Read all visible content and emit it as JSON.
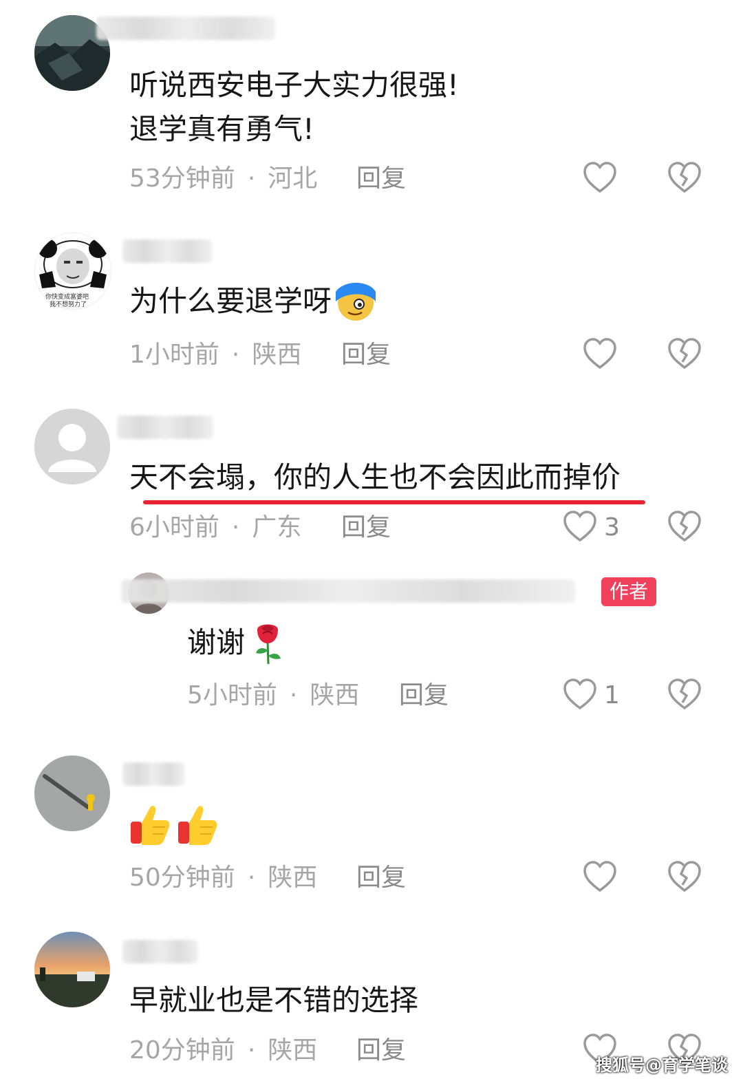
{
  "comments": [
    {
      "text_lines": [
        "听说西安电子大实力很强!",
        "退学真有勇气!"
      ],
      "time": "53分钟前",
      "location": "河北",
      "reply_label": "回复",
      "like_count": "",
      "avatar_icon": "avatar-dark-landscape"
    },
    {
      "text": "为什么要退学呀",
      "emoji": "face-emoji",
      "time": "1小时前",
      "location": "陕西",
      "reply_label": "回复",
      "like_count": "",
      "avatar_icon": "avatar-panda-meme",
      "avatar_caption_1": "你快变成富婆吧",
      "avatar_caption_2": "我不想努力了"
    },
    {
      "text": "天不会塌，你的人生也不会因此而掉价",
      "time": "6小时前",
      "location": "广东",
      "reply_label": "回复",
      "like_count": "3",
      "highlight_color": "#e8232f",
      "avatar_icon": "avatar-default-person",
      "replies": [
        {
          "badge": "作者",
          "text": "谢谢",
          "emoji": "rose-emoji",
          "time": "5小时前",
          "location": "陕西",
          "reply_label": "回复",
          "like_count": "1"
        }
      ]
    },
    {
      "emoji": "thumbs-up-emoji x2",
      "time": "50分钟前",
      "location": "陕西",
      "reply_label": "回复",
      "like_count": "",
      "avatar_icon": "avatar-shadow-ground"
    },
    {
      "text": "早就业也是不错的选择",
      "time": "20分钟前",
      "location": "陕西",
      "reply_label": "回复",
      "like_count": "",
      "avatar_icon": "avatar-sunset"
    }
  ],
  "watermark": "搜狐号@育学笔谈",
  "colors": {
    "text": "#161616",
    "meta": "#a6a6a6",
    "badge": "#f0405b",
    "underline": "#e8232f"
  }
}
